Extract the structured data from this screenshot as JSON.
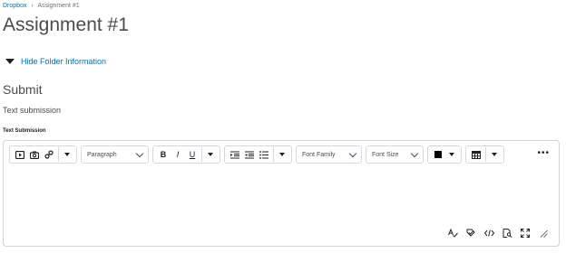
{
  "breadcrumb": {
    "items": [
      "Dropbox",
      "Assignment #1"
    ],
    "separator": "›"
  },
  "page": {
    "title": "Assignment #1"
  },
  "folder_toggle": {
    "label": "Hide Folder Information"
  },
  "submit": {
    "title": "Submit",
    "subtitle": "Text submission"
  },
  "editor": {
    "field_label": "Text Submission",
    "paragraph_select": "Paragraph",
    "font_family_select": "Font Family",
    "font_size_select": "Font Size",
    "bold_label": "B",
    "italic_label": "I",
    "underline_label": "U",
    "more_label": "•••",
    "text_color": "#000000",
    "icons": {
      "insert_video": "video-icon",
      "insert_image": "camera-icon",
      "insert_link": "link-icon",
      "indent": "indent-icon",
      "outdent": "outdent-icon",
      "list": "list-icon",
      "table": "table-icon",
      "spellcheck": "spellcheck-icon",
      "accessibility": "accessibility-icon",
      "source_code": "code-icon",
      "preview": "preview-icon",
      "fullscreen": "fullscreen-icon",
      "resize": "resize-icon"
    }
  },
  "colors": {
    "link": "#006fbf",
    "text": "#494c4e",
    "border": "#cdd5dc"
  }
}
